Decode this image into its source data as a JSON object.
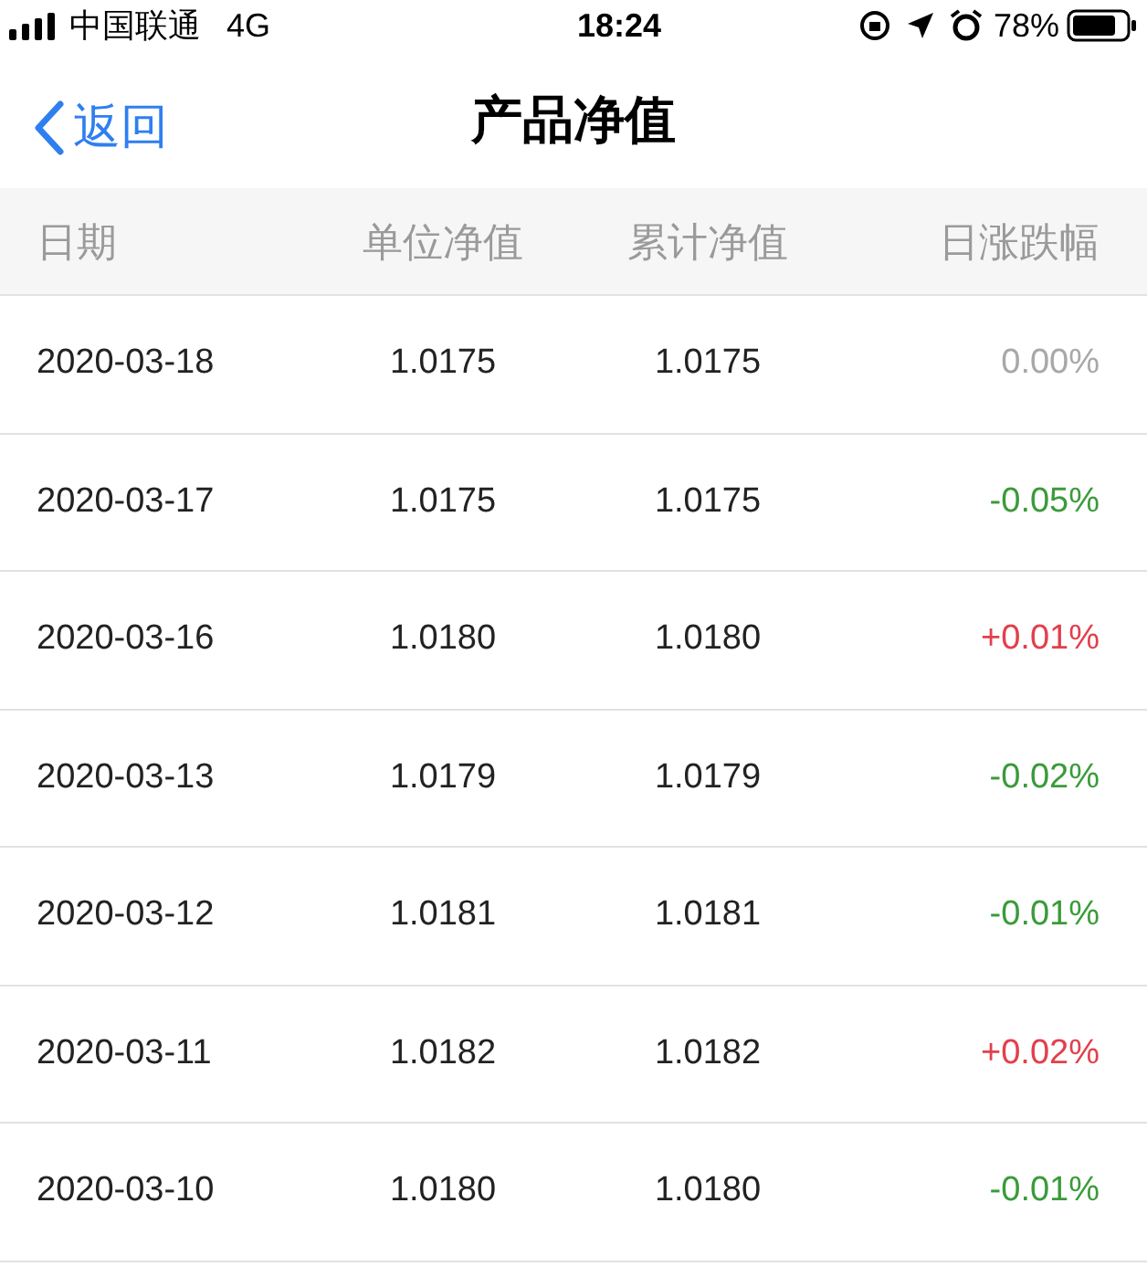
{
  "status_bar": {
    "carrier": "中国联通",
    "network": "4G",
    "time": "18:24",
    "battery": "78%"
  },
  "nav": {
    "back": "返回",
    "title": "产品净值"
  },
  "table": {
    "columns": [
      "日期",
      "单位净值",
      "累计净值",
      "日涨跌幅"
    ],
    "rows": [
      {
        "date": "2020-03-18",
        "unit": "1.0175",
        "cumulative": "1.0175",
        "change": "0.00%",
        "kind": "flat"
      },
      {
        "date": "2020-03-17",
        "unit": "1.0175",
        "cumulative": "1.0175",
        "change": "-0.05%",
        "kind": "down"
      },
      {
        "date": "2020-03-16",
        "unit": "1.0180",
        "cumulative": "1.0180",
        "change": "+0.01%",
        "kind": "up"
      },
      {
        "date": "2020-03-13",
        "unit": "1.0179",
        "cumulative": "1.0179",
        "change": "-0.02%",
        "kind": "down"
      },
      {
        "date": "2020-03-12",
        "unit": "1.0181",
        "cumulative": "1.0181",
        "change": "-0.01%",
        "kind": "down"
      },
      {
        "date": "2020-03-11",
        "unit": "1.0182",
        "cumulative": "1.0182",
        "change": "+0.02%",
        "kind": "up"
      },
      {
        "date": "2020-03-10",
        "unit": "1.0180",
        "cumulative": "1.0180",
        "change": "-0.01%",
        "kind": "down"
      }
    ]
  }
}
